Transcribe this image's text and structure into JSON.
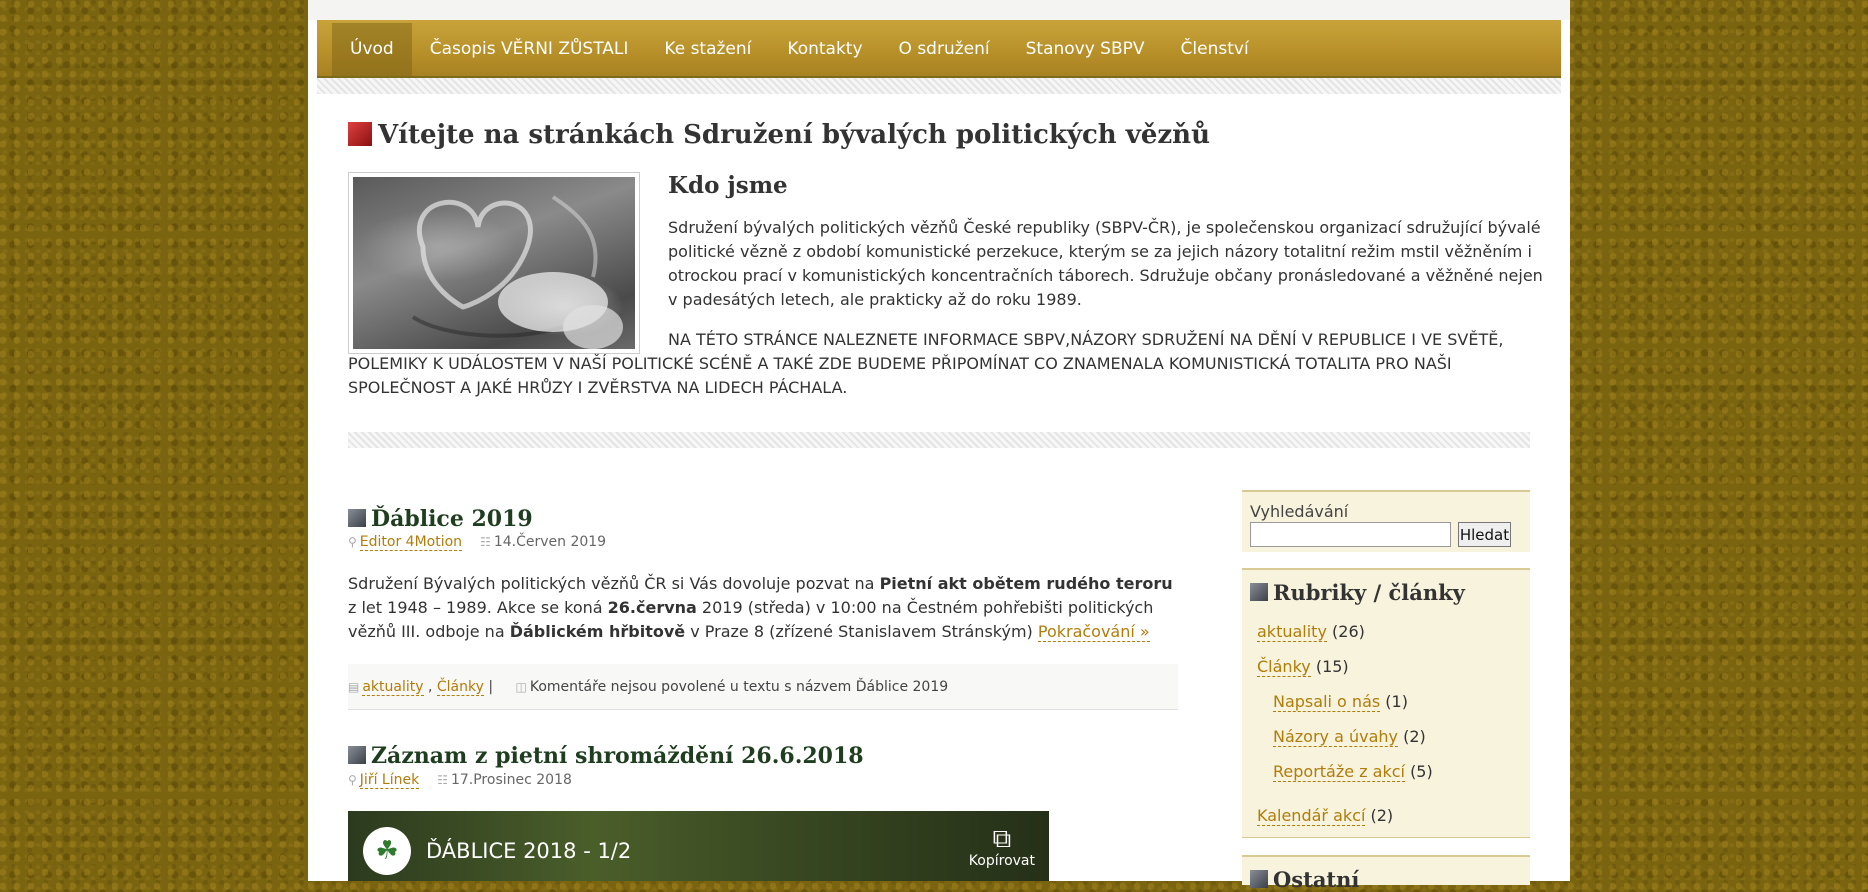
{
  "nav": {
    "items": [
      {
        "label": "Úvod"
      },
      {
        "label": "Časopis VĚRNI ZŮSTALI"
      },
      {
        "label": "Ke stažení"
      },
      {
        "label": "Kontakty"
      },
      {
        "label": "O sdružení"
      },
      {
        "label": "Stanovy SBPV"
      },
      {
        "label": "Členství"
      }
    ]
  },
  "intro": {
    "title": "Vítejte na stránkách Sdružení bývalých politických vězňů",
    "heading": "Kdo jsme",
    "paragraph1": "Sdružení bývalých politických vězňů České republiky (SBPV-ČR), je společenskou organizací sdružující bývalé politické vězně z období komunistické perzekuce, kterým se za jejich názory totalitní režim mstil věžněním i otrockou prací v komunistických koncentračních táborech. Sdružuje občany pronásledované a věžněné nejen v padesátých letech, ale prakticky až do roku 1989.",
    "paragraph2": "NA TÉTO STRÁNCE NALEZNETE INFORMACE SBPV,NÁZORY SDRUŽENÍ NA DĚNÍ V REPUBLICE I VE SVĚTĚ, POLEMIKY K UDÁLOSTEM V NAŠÍ POLITICKÉ SCÉNĚ A TAKÉ ZDE BUDEME PŘIPOMÍNAT CO ZNAMENALA KOMUNISTICKÁ TOTALITA PRO NAŠI SPOLEČNOST A JAKÉ HRŮZY I ZVĚRSTVA NA LIDECH PÁCHALA."
  },
  "posts": [
    {
      "title": "Ďáblice 2019",
      "author": "Editor 4Motion",
      "date": "14.Červen 2019",
      "excerpt_a": "Sdružení Bývalých politických vězňů ČR si Vás dovoluje pozvat na ",
      "excerpt_b": "Pietní akt obětem rudého teroru",
      "excerpt_c": " z let 1948 – 1989. Akce se koná ",
      "excerpt_d": "26.června",
      "excerpt_e": " 2019 (středa) v 10:00 na Čestném pohřebišti politických vězňů III. odboje na ",
      "excerpt_f": "Ďáblickém hřbitově",
      "excerpt_g": " v Praze 8 (zřízené Stanislavem Stránským) ",
      "more": "Pokračování »",
      "cat1": "aktuality",
      "cat_sep": " , ",
      "cat2": "Články",
      "divider": " | ",
      "comments": "Komentáře nejsou povolené u textu s názvem Ďáblice 2019"
    },
    {
      "title": "Záznam z pietní shromáždění 26.6.2018",
      "author": "Jiří Línek",
      "date": "17.Prosinec 2018",
      "video_title": "ĎÁBLICE 2018 - 1/2",
      "video_copy": "Kopírovat"
    }
  ],
  "search": {
    "label": "Vyhledávání",
    "value": "",
    "button": "Hledat"
  },
  "categories": {
    "title": "Rubriky / články",
    "items": [
      {
        "label": "aktuality",
        "count": "(26)"
      },
      {
        "label": "Články",
        "count": "(15)"
      },
      {
        "label": "Napsali o nás",
        "count": "(1)"
      },
      {
        "label": "Názory a úvahy",
        "count": "(2)"
      },
      {
        "label": "Reportáže z akcí",
        "count": "(5)"
      },
      {
        "label": "Kalendář akcí",
        "count": "(2)"
      }
    ]
  },
  "other": {
    "title": "Ostatní"
  },
  "colors": {
    "background": "#7a6410",
    "nav": "#b8912a",
    "link": "#b07d0b",
    "sidebar": "#f8f3dc"
  }
}
